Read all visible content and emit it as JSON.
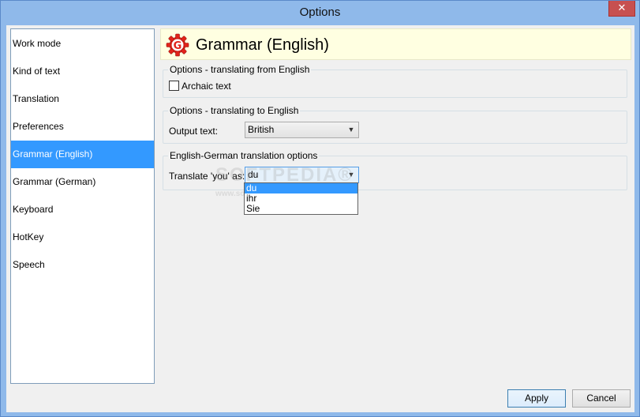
{
  "window": {
    "title": "Options",
    "close_glyph": "✕"
  },
  "nav": {
    "items": [
      {
        "label": "Work mode"
      },
      {
        "label": "Kind of text"
      },
      {
        "label": "Translation"
      },
      {
        "label": "Preferences"
      },
      {
        "label": "Grammar (English)",
        "selected": true
      },
      {
        "label": "Grammar (German)"
      },
      {
        "label": "Keyboard"
      },
      {
        "label": "HotKey"
      },
      {
        "label": "Speech"
      }
    ]
  },
  "header": {
    "title": "Grammar (English)",
    "icon": "gear-g-icon",
    "icon_letter": "G",
    "accent": "#e2231a"
  },
  "group_from": {
    "legend": "Options - translating from English",
    "archaic_label": "Archaic text",
    "archaic_checked": false
  },
  "group_to": {
    "legend": "Options - translating to English",
    "output_label": "Output text:",
    "output_value": "British"
  },
  "group_eg": {
    "legend": "English-German translation options",
    "you_label": "Translate 'you' as:",
    "you_value": "du",
    "options": [
      "du",
      "ihr",
      "Sie"
    ]
  },
  "buttons": {
    "apply": "Apply",
    "cancel": "Cancel"
  },
  "watermark": {
    "main": "SOFTPEDIA",
    "sub": "www.softpedia.com",
    "mark": "®"
  },
  "colors": {
    "selection": "#3399ff",
    "titlebar": "#8fb9ea",
    "header_bg": "#ffffe1"
  }
}
